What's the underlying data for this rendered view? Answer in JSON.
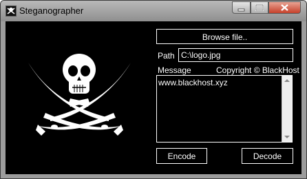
{
  "window": {
    "title": "Steganographer"
  },
  "form": {
    "browse_label": "Browse file..",
    "path_label": "Path",
    "path_value": "C:\\logo.jpg",
    "message_label": "Message",
    "copyright": "Copyright © BlackHost",
    "message_text": "www.blackhost.xyz",
    "encode_label": "Encode",
    "decode_label": "Decode"
  },
  "colors": {
    "background": "#000000",
    "foreground": "#ffffff",
    "close_button": "#c7402a"
  }
}
